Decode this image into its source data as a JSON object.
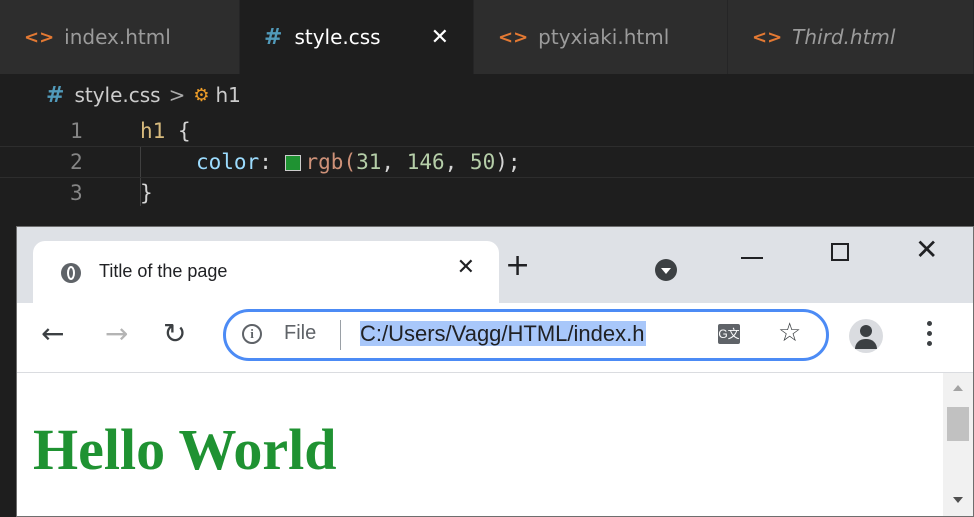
{
  "vscode": {
    "tabs": [
      {
        "label": "index.html",
        "icon": "html-icon",
        "active": false
      },
      {
        "label": "style.css",
        "icon": "css-icon",
        "active": true
      },
      {
        "label": "ptyxiaki.html",
        "icon": "html-icon",
        "active": false
      },
      {
        "label": "Third.html",
        "icon": "html-icon",
        "active": false,
        "italic": true
      }
    ],
    "icons": {
      "html": "<>",
      "css": "#",
      "close": "✕"
    },
    "breadcrumb": {
      "file": "style.css",
      "separator": ">",
      "symbol": "h1"
    },
    "lines": [
      {
        "number": "1",
        "selector": "h1",
        "brace": " {"
      },
      {
        "number": "2",
        "property": "color",
        "colon": ": ",
        "func": "rgb(",
        "r": "31",
        "g": "146",
        "b": "50",
        "end": ");",
        "comma": ", ",
        "swatch_color": "#1f9232"
      },
      {
        "number": "3",
        "brace": "}"
      }
    ]
  },
  "browser": {
    "tab_title": "Title of the page",
    "tab_close": "✕",
    "new_tab": "+",
    "window": {
      "minimize": "—",
      "close": "✕"
    },
    "nav": {
      "back": "←",
      "forward": "→",
      "reload": "C"
    },
    "omnibox": {
      "info": "i",
      "scheme": "File",
      "url": "C:/Users/Vagg/HTML/index.h",
      "star": "☆",
      "translate": "G文"
    },
    "page": {
      "heading": "Hello World",
      "heading_color": "#1f9232"
    }
  }
}
